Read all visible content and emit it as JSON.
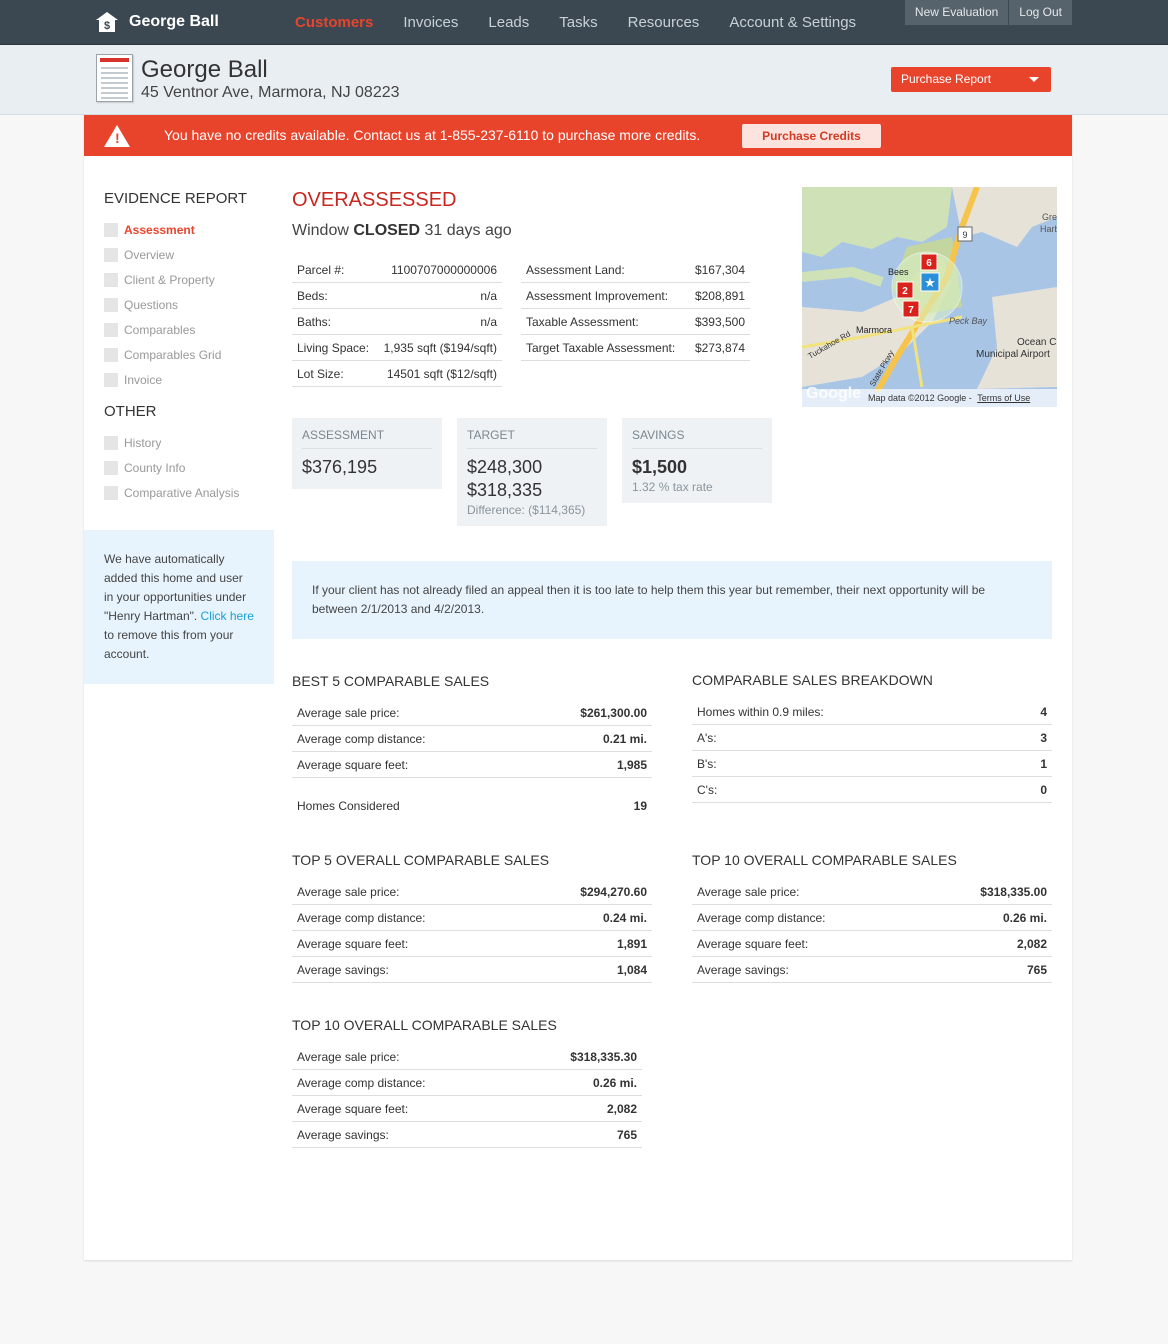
{
  "brand": {
    "name": "George Ball",
    "icon": "house-dollar-icon"
  },
  "nav": {
    "items": [
      "Customers",
      "Invoices",
      "Leads",
      "Tasks",
      "Resources",
      "Account & Settings"
    ],
    "active": "Customers"
  },
  "top_buttons": {
    "new_evaluation": "New Evaluation",
    "logout": "Log Out"
  },
  "header": {
    "name": "George Ball",
    "address": "45 Ventnor Ave, Marmora, NJ 08223",
    "purchase_report": "Purchase Report"
  },
  "alert": {
    "text": "You have no credits available. Contact us at 1-855-237-6110 to purchase more credits.",
    "button": "Purchase Credits",
    "icon": "warning-icon"
  },
  "sidebar": {
    "evidence_title": "EVIDENCE REPORT",
    "evidence_items": [
      "Assessment",
      "Overview",
      "Client & Property",
      "Questions",
      "Comparables",
      "Comparables Grid",
      "Invoice"
    ],
    "other_title": "OTHER",
    "other_items": [
      "History",
      "County Info",
      "Comparative Analysis"
    ],
    "note": {
      "text1": "We have automatically added this home and user in your opportunities under \"Henry Hartman\". ",
      "link": "Click here",
      "text2": " to remove this from your account."
    }
  },
  "status": {
    "title": "OVERASSESSED",
    "window_prefix": "Window ",
    "window_state": "CLOSED",
    "window_suffix": " 31 days ago"
  },
  "property": [
    {
      "label": "Parcel #:",
      "value": "1100707000000006"
    },
    {
      "label": "Beds:",
      "value": "n/a"
    },
    {
      "label": "Baths:",
      "value": "n/a"
    },
    {
      "label": "Living Space:",
      "value": "1,935 sqft ($194/sqft)"
    },
    {
      "label": "Lot Size:",
      "value": "14501 sqft ($12/sqft)"
    }
  ],
  "assessment": [
    {
      "label": "Assessment Land:",
      "value": "$167,304"
    },
    {
      "label": "Assessment Improvement:",
      "value": "$208,891"
    },
    {
      "label": "Taxable Assessment:",
      "value": "$393,500"
    },
    {
      "label": "Target Taxable Assessment:",
      "value": "$273,874"
    }
  ],
  "summary": {
    "assessment": {
      "label": "ASSESSMENT",
      "value": "$376,195"
    },
    "target": {
      "label": "TARGET",
      "value1": "$248,300",
      "value2": "$318,335",
      "diff": "Difference: ($114,365)"
    },
    "savings": {
      "label": "SAVINGS",
      "value": "$1,500",
      "rate": "1.32 % tax rate"
    }
  },
  "map": {
    "labels": {
      "bees": "Bees",
      "marmora": "Marmora",
      "peck_bay": "Peck Bay",
      "ocean_city": "Ocean City",
      "municipal_airport": "Municipal Airport",
      "tuckahoe": "Tuckahoe Rd",
      "route": "9",
      "gre": "Gre",
      "harb": "Harb",
      "pkwy": "State Pkwy"
    },
    "markers": [
      "6",
      "2",
      "7"
    ],
    "attribution": "Map data ©2012 Google - ",
    "terms": "Terms of Use",
    "logo": "Google"
  },
  "info": "If your client has not already filed an appeal then it is too late to help them this year but remember, their next opportunity will be between 2/1/2013 and 4/2/2013.",
  "best5": {
    "title": "BEST 5 COMPARABLE SALES",
    "rows": [
      {
        "label": "Average sale price:",
        "value": "$261,300.00"
      },
      {
        "label": "Average comp distance:",
        "value": "0.21 mi."
      },
      {
        "label": "Average square feet:",
        "value": "1,985"
      }
    ],
    "considered": {
      "label": "Homes Considered",
      "value": "19"
    }
  },
  "breakdown": {
    "title": "COMPARABLE SALES BREAKDOWN",
    "rows": [
      {
        "label": "Homes within 0.9 miles:",
        "value": "4"
      },
      {
        "label": "A's:",
        "value": "3"
      },
      {
        "label": "B's:",
        "value": "1"
      },
      {
        "label": "C's:",
        "value": "0"
      }
    ]
  },
  "top5": {
    "title": "TOP 5 OVERALL COMPARABLE SALES",
    "rows": [
      {
        "label": "Average sale price:",
        "value": "$294,270.60"
      },
      {
        "label": "Average comp distance:",
        "value": "0.24 mi."
      },
      {
        "label": "Average square feet:",
        "value": "1,891"
      },
      {
        "label": "Average savings:",
        "value": "1,084"
      }
    ]
  },
  "top10a": {
    "title": "TOP 10 OVERALL COMPARABLE SALES",
    "rows": [
      {
        "label": "Average sale price:",
        "value": "$318,335.00"
      },
      {
        "label": "Average comp distance:",
        "value": "0.26 mi."
      },
      {
        "label": "Average square feet:",
        "value": "2,082"
      },
      {
        "label": "Average savings:",
        "value": "765"
      }
    ]
  },
  "top10b": {
    "title": "TOP 10 OVERALL COMPARABLE SALES",
    "rows": [
      {
        "label": "Average sale price:",
        "value": "$318,335.30"
      },
      {
        "label": "Average comp distance:",
        "value": "0.26 mi."
      },
      {
        "label": "Average square feet:",
        "value": "2,082"
      },
      {
        "label": "Average savings:",
        "value": "765"
      }
    ]
  },
  "colors": {
    "accent": "#e8442c",
    "nav_bg": "#3b4852",
    "over": "#c8261f",
    "link": "#1aa0d8"
  }
}
